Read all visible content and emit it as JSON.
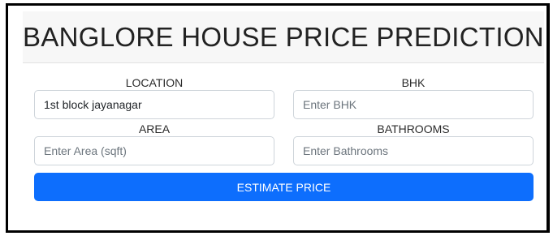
{
  "header": {
    "title": "BANGLORE HOUSE PRICE PREDICTION"
  },
  "form": {
    "location": {
      "label": "LOCATION",
      "value": "1st block jayanagar"
    },
    "bhk": {
      "label": "BHK",
      "placeholder": "Enter BHK",
      "value": ""
    },
    "area": {
      "label": "AREA",
      "placeholder": "Enter Area (sqft)",
      "value": ""
    },
    "bathrooms": {
      "label": "BATHROOMS",
      "placeholder": "Enter Bathrooms",
      "value": ""
    },
    "submit_label": "ESTIMATE PRICE"
  },
  "colors": {
    "accent": "#0d6efd",
    "header_bg": "#f7f7f7",
    "frame_border": "#000000"
  }
}
